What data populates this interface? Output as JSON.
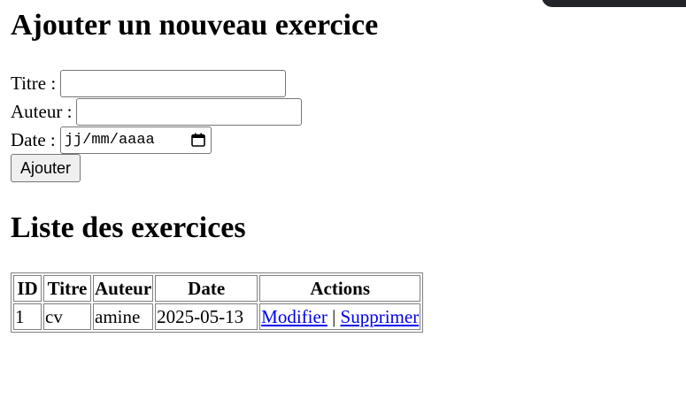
{
  "form": {
    "title": "Ajouter un nouveau exercice",
    "titre_label": "Titre :",
    "titre_value": "",
    "auteur_label": "Auteur :",
    "auteur_value": "",
    "date_label": "Date :",
    "date_placeholder": "jj/mm/aaaa",
    "submit_label": "Ajouter"
  },
  "list": {
    "title": "Liste des exercices",
    "columns": [
      "ID",
      "Titre",
      "Auteur",
      "Date",
      "Actions"
    ],
    "rows": [
      {
        "id": "1",
        "titre": "cv",
        "auteur": "amine",
        "date": "2025-05-13",
        "edit": "Modifier",
        "separator": "|",
        "delete": "Supprimer"
      }
    ]
  },
  "colors": {
    "link": "#0000ee",
    "border": "#808080",
    "button_bg": "#efefef"
  },
  "icons": {
    "date_picker": "calendar-icon"
  }
}
